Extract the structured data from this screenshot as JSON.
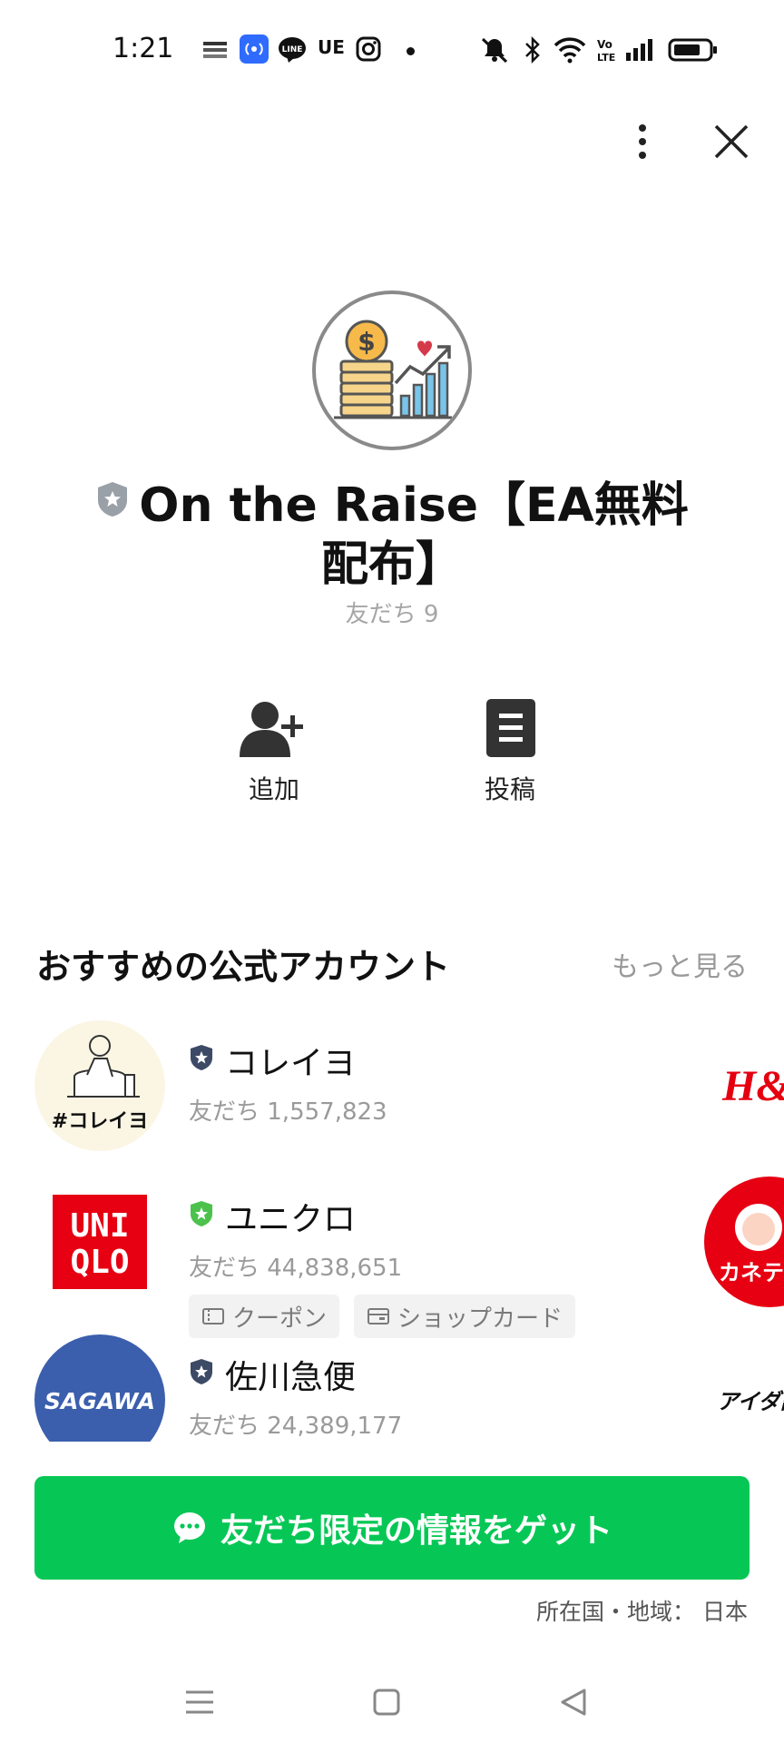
{
  "status_bar": {
    "time": "1:21",
    "text_ue": "UE",
    "icons": [
      "app-notification-icon",
      "broadcast-icon",
      "line-icon",
      "instagram-icon",
      "mute-icon",
      "bluetooth-icon",
      "wifi-icon",
      "volte-icon",
      "signal-icon",
      "battery-icon"
    ]
  },
  "account": {
    "name": "On the Raise【EA無料配布】",
    "friends": "友だち 9"
  },
  "actions": {
    "add_label": "追加",
    "post_label": "投稿"
  },
  "recommendations": {
    "title": "おすすめの公式アカウント",
    "more": "もっと見る",
    "items": [
      {
        "name": "コレイヨ",
        "friends": "友だち 1,557,823",
        "logo_text": "#コレイヨ",
        "badge_color": "#3d4a66"
      },
      {
        "name": "ユニクロ",
        "friends": "友だち 44,838,651",
        "logo_text_1": "UNI",
        "logo_text_2": "QLO",
        "badge_color": "#4cc24c",
        "tags": [
          "クーポン",
          "ショップカード"
        ]
      },
      {
        "name": "佐川急便",
        "friends": "友だち 24,389,177",
        "logo_text": "SAGAWA",
        "badge_color": "#3d4a66"
      }
    ],
    "peek": {
      "hm": "H&M",
      "kanebo": "カネテ",
      "aida": "アイダ設"
    }
  },
  "cta": {
    "label": "友だち限定の情報をゲット"
  },
  "region": "所在国・地域： 日本",
  "colors": {
    "line_green": "#06c755"
  }
}
